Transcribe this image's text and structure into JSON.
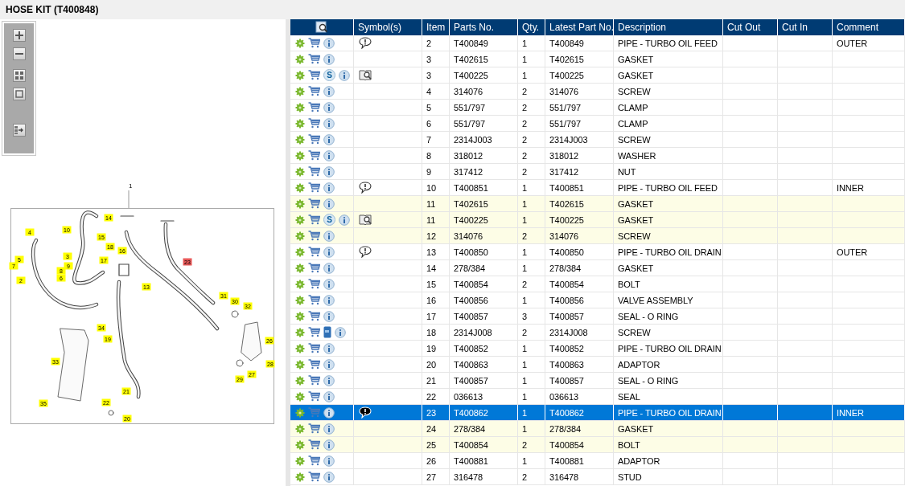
{
  "title": "HOSE KIT (T400848)",
  "diagram": {
    "assembly_label": "1",
    "callouts": [
      {
        "number": "14",
        "highlighted": false
      },
      {
        "number": "10",
        "highlighted": false
      },
      {
        "number": "4",
        "highlighted": false
      },
      {
        "number": "15",
        "highlighted": false
      },
      {
        "number": "18",
        "highlighted": false
      },
      {
        "number": "16",
        "highlighted": false
      },
      {
        "number": "3",
        "highlighted": false
      },
      {
        "number": "9",
        "highlighted": false
      },
      {
        "number": "5",
        "highlighted": false
      },
      {
        "number": "17",
        "highlighted": false
      },
      {
        "number": "8",
        "highlighted": false
      },
      {
        "number": "23",
        "highlighted": true
      },
      {
        "number": "7",
        "highlighted": false
      },
      {
        "number": "6",
        "highlighted": false
      },
      {
        "number": "2",
        "highlighted": false
      },
      {
        "number": "13",
        "highlighted": false
      },
      {
        "number": "31",
        "highlighted": false
      },
      {
        "number": "30",
        "highlighted": false
      },
      {
        "number": "32",
        "highlighted": false
      },
      {
        "number": "34",
        "highlighted": false
      },
      {
        "number": "19",
        "highlighted": false
      },
      {
        "number": "26",
        "highlighted": false
      },
      {
        "number": "33",
        "highlighted": false
      },
      {
        "number": "28",
        "highlighted": false
      },
      {
        "number": "27",
        "highlighted": false
      },
      {
        "number": "29",
        "highlighted": false
      },
      {
        "number": "21",
        "highlighted": false
      },
      {
        "number": "22",
        "highlighted": false
      },
      {
        "number": "35",
        "highlighted": false
      },
      {
        "number": "20",
        "highlighted": false
      }
    ]
  },
  "table": {
    "columns": [
      "Symbol(s)",
      "Item",
      "Parts No.",
      "Qty.",
      "Latest Part No.",
      "Description",
      "Cut Out",
      "Cut In",
      "Comment"
    ],
    "rows": [
      {
        "item": "2",
        "parts_no": "T400849",
        "qty": "1",
        "latest_part_no": "T400849",
        "description": "PIPE - TURBO OIL FEED",
        "comment": "OUTER",
        "symbol": {
          "kind": "note"
        },
        "manual": false,
        "highlighted": false,
        "selected": false
      },
      {
        "item": "3",
        "parts_no": "T402615",
        "qty": "1",
        "latest_part_no": "T402615",
        "description": "GASKET",
        "manual": false,
        "highlighted": false,
        "selected": false
      },
      {
        "item": "3",
        "parts_no": "T400225",
        "qty": "1",
        "latest_part_no": "T400225",
        "description": "GASKET",
        "badge": "S",
        "symbol": {
          "kind": "illustration"
        },
        "manual": false,
        "highlighted": false,
        "selected": false
      },
      {
        "item": "4",
        "parts_no": "314076",
        "qty": "2",
        "latest_part_no": "314076",
        "description": "SCREW",
        "manual": false,
        "highlighted": false,
        "selected": false
      },
      {
        "item": "5",
        "parts_no": "551/797",
        "qty": "2",
        "latest_part_no": "551/797",
        "description": "CLAMP",
        "manual": false,
        "highlighted": false,
        "selected": false
      },
      {
        "item": "6",
        "parts_no": "551/797",
        "qty": "2",
        "latest_part_no": "551/797",
        "description": "CLAMP",
        "manual": false,
        "highlighted": false,
        "selected": false
      },
      {
        "item": "7",
        "parts_no": "2314J003",
        "qty": "2",
        "latest_part_no": "2314J003",
        "description": "SCREW",
        "manual": false,
        "highlighted": false,
        "selected": false
      },
      {
        "item": "8",
        "parts_no": "318012",
        "qty": "2",
        "latest_part_no": "318012",
        "description": "WASHER",
        "manual": false,
        "highlighted": false,
        "selected": false
      },
      {
        "item": "9",
        "parts_no": "317412",
        "qty": "2",
        "latest_part_no": "317412",
        "description": "NUT",
        "manual": false,
        "highlighted": false,
        "selected": false
      },
      {
        "item": "10",
        "parts_no": "T400851",
        "qty": "1",
        "latest_part_no": "T400851",
        "description": "PIPE - TURBO OIL FEED",
        "comment": "INNER",
        "symbol": {
          "kind": "note"
        },
        "manual": false,
        "highlighted": false,
        "selected": false
      },
      {
        "item": "11",
        "parts_no": "T402615",
        "qty": "1",
        "latest_part_no": "T402615",
        "description": "GASKET",
        "manual": false,
        "highlighted": true,
        "selected": false
      },
      {
        "item": "11",
        "parts_no": "T400225",
        "qty": "1",
        "latest_part_no": "T400225",
        "description": "GASKET",
        "badge": "S",
        "symbol": {
          "kind": "illustration"
        },
        "manual": false,
        "highlighted": true,
        "selected": false
      },
      {
        "item": "12",
        "parts_no": "314076",
        "qty": "2",
        "latest_part_no": "314076",
        "description": "SCREW",
        "manual": false,
        "highlighted": true,
        "selected": false
      },
      {
        "item": "13",
        "parts_no": "T400850",
        "qty": "1",
        "latest_part_no": "T400850",
        "description": "PIPE - TURBO OIL DRAIN",
        "comment": "OUTER",
        "symbol": {
          "kind": "note"
        },
        "manual": false,
        "highlighted": false,
        "selected": false
      },
      {
        "item": "14",
        "parts_no": "278/384",
        "qty": "1",
        "latest_part_no": "278/384",
        "description": "GASKET",
        "manual": false,
        "highlighted": false,
        "selected": false
      },
      {
        "item": "15",
        "parts_no": "T400854",
        "qty": "2",
        "latest_part_no": "T400854",
        "description": "BOLT",
        "manual": false,
        "highlighted": false,
        "selected": false
      },
      {
        "item": "16",
        "parts_no": "T400856",
        "qty": "1",
        "latest_part_no": "T400856",
        "description": "VALVE ASSEMBLY",
        "manual": false,
        "highlighted": false,
        "selected": false
      },
      {
        "item": "17",
        "parts_no": "T400857",
        "qty": "3",
        "latest_part_no": "T400857",
        "description": "SEAL - O RING",
        "manual": false,
        "highlighted": false,
        "selected": false
      },
      {
        "item": "18",
        "parts_no": "2314J008",
        "qty": "2",
        "latest_part_no": "2314J008",
        "description": "SCREW",
        "manual": true,
        "highlighted": false,
        "selected": false
      },
      {
        "item": "19",
        "parts_no": "T400852",
        "qty": "1",
        "latest_part_no": "T400852",
        "description": "PIPE - TURBO OIL DRAIN",
        "manual": false,
        "highlighted": false,
        "selected": false
      },
      {
        "item": "20",
        "parts_no": "T400863",
        "qty": "1",
        "latest_part_no": "T400863",
        "description": "ADAPTOR",
        "manual": false,
        "highlighted": false,
        "selected": false
      },
      {
        "item": "21",
        "parts_no": "T400857",
        "qty": "1",
        "latest_part_no": "T400857",
        "description": "SEAL - O RING",
        "manual": false,
        "highlighted": false,
        "selected": false
      },
      {
        "item": "22",
        "parts_no": "036613",
        "qty": "1",
        "latest_part_no": "036613",
        "description": "SEAL",
        "manual": false,
        "highlighted": false,
        "selected": false
      },
      {
        "item": "23",
        "parts_no": "T400862",
        "qty": "1",
        "latest_part_no": "T400862",
        "description": "PIPE - TURBO OIL DRAIN",
        "comment": "INNER",
        "symbol": {
          "kind": "note"
        },
        "manual": false,
        "highlighted": false,
        "selected": true
      },
      {
        "item": "24",
        "parts_no": "278/384",
        "qty": "1",
        "latest_part_no": "278/384",
        "description": "GASKET",
        "manual": false,
        "highlighted": true,
        "selected": false
      },
      {
        "item": "25",
        "parts_no": "T400854",
        "qty": "2",
        "latest_part_no": "T400854",
        "description": "BOLT",
        "manual": false,
        "highlighted": true,
        "selected": false
      },
      {
        "item": "26",
        "parts_no": "T400881",
        "qty": "1",
        "latest_part_no": "T400881",
        "description": "ADAPTOR",
        "manual": false,
        "highlighted": false,
        "selected": false
      },
      {
        "item": "27",
        "parts_no": "316478",
        "qty": "2",
        "latest_part_no": "316478",
        "description": "STUD",
        "manual": false,
        "highlighted": false,
        "selected": false
      }
    ]
  }
}
